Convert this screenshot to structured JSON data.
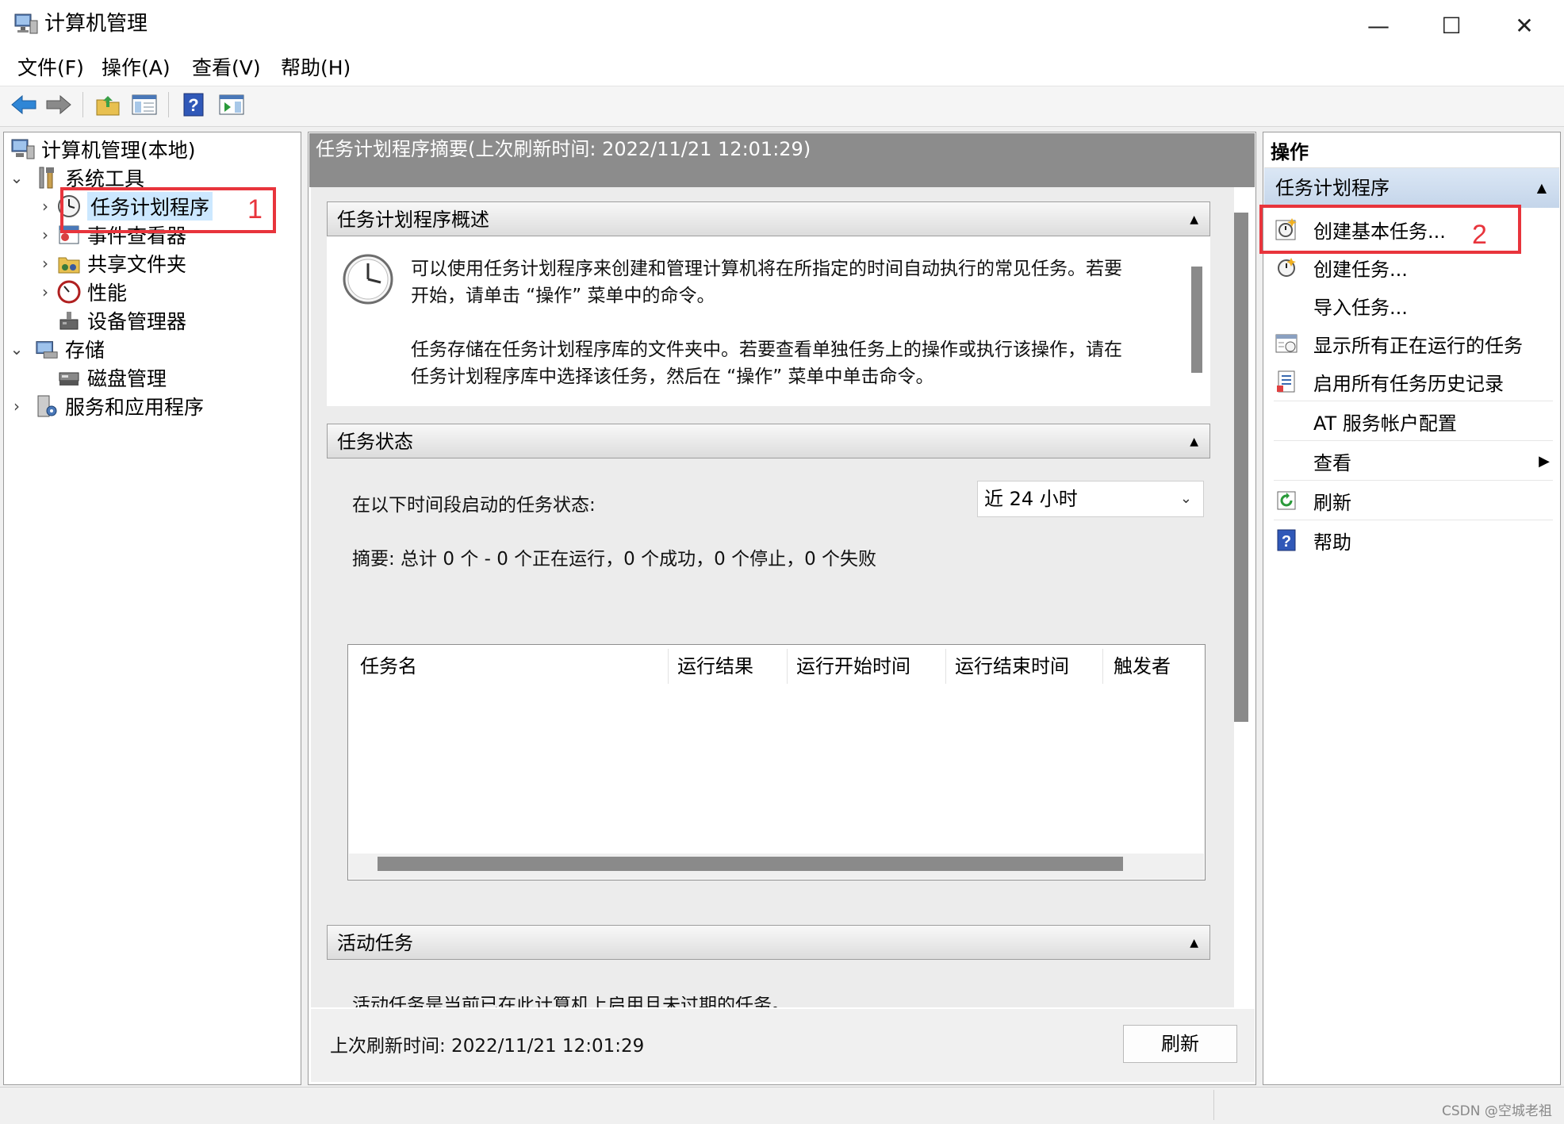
{
  "window": {
    "title": "计算机管理",
    "minimize_glyph": "—",
    "maximize_glyph": "☐",
    "close_glyph": "✕"
  },
  "menu": [
    "文件(F)",
    "操作(A)",
    "查看(V)",
    "帮助(H)"
  ],
  "toolbar": {
    "icons": [
      "back-arrow-icon",
      "forward-arrow-icon",
      "up-folder-icon",
      "show-hide-tree-icon",
      "help-icon",
      "show-hide-action-pane-icon"
    ]
  },
  "tree": {
    "root": "计算机管理(本地)",
    "system_tools": "系统工具",
    "task_scheduler": "任务计划程序",
    "event_viewer": "事件查看器",
    "shared_folders": "共享文件夹",
    "performance": "性能",
    "device_manager": "设备管理器",
    "storage": "存储",
    "disk_management": "磁盘管理",
    "services_apps": "服务和应用程序"
  },
  "center": {
    "header": "任务计划程序摘要(上次刷新时间: 2022/11/21 12:01:29)",
    "overview": {
      "title": "任务计划程序概述",
      "para1_line1": "可以使用任务计划程序来创建和管理计算机将在所指定的时间自动执行的常见任务。若要",
      "para1_line2": "开始，请单击 “操作” 菜单中的命令。",
      "para2_line1": "任务存储在任务计划程序库的文件夹中。若要查看单独任务上的操作或执行该操作，请在",
      "para2_line2": "任务计划程序库中选择该任务，然后在 “操作” 菜单中单击命令。"
    },
    "status": {
      "title": "任务状态",
      "period_label": "在以下时间段启动的任务状态:",
      "period_value": "近 24 小时",
      "summary": "摘要: 总计 0 个 - 0 个正在运行，0 个成功，0 个停止，0 个失败",
      "columns": [
        "任务名",
        "运行结果",
        "运行开始时间",
        "运行结束时间",
        "触发者"
      ]
    },
    "active": {
      "title": "活动任务",
      "partial_text": "活动任务是当前已在此计算机上启用且未过期的任务。"
    },
    "footer": {
      "last_refresh": "上次刷新时间: 2022/11/21 12:01:29",
      "refresh_button": "刷新"
    }
  },
  "actions": {
    "pane_title": "操作",
    "group_title": "任务计划程序",
    "items": [
      "创建基本任务...",
      "创建任务...",
      "导入任务...",
      "显示所有正在运行的任务",
      "启用所有任务历史记录",
      "AT 服务帐户配置",
      "查看",
      "刷新",
      "帮助"
    ]
  },
  "annotations": {
    "num1": "1",
    "num2": "2",
    "color": "#e8343c"
  },
  "watermark": "CSDN @空城老祖",
  "colors": {
    "header_gray": "#8c8c8c",
    "selection": "#cce8ff",
    "action_group": "#c4d5ea"
  }
}
